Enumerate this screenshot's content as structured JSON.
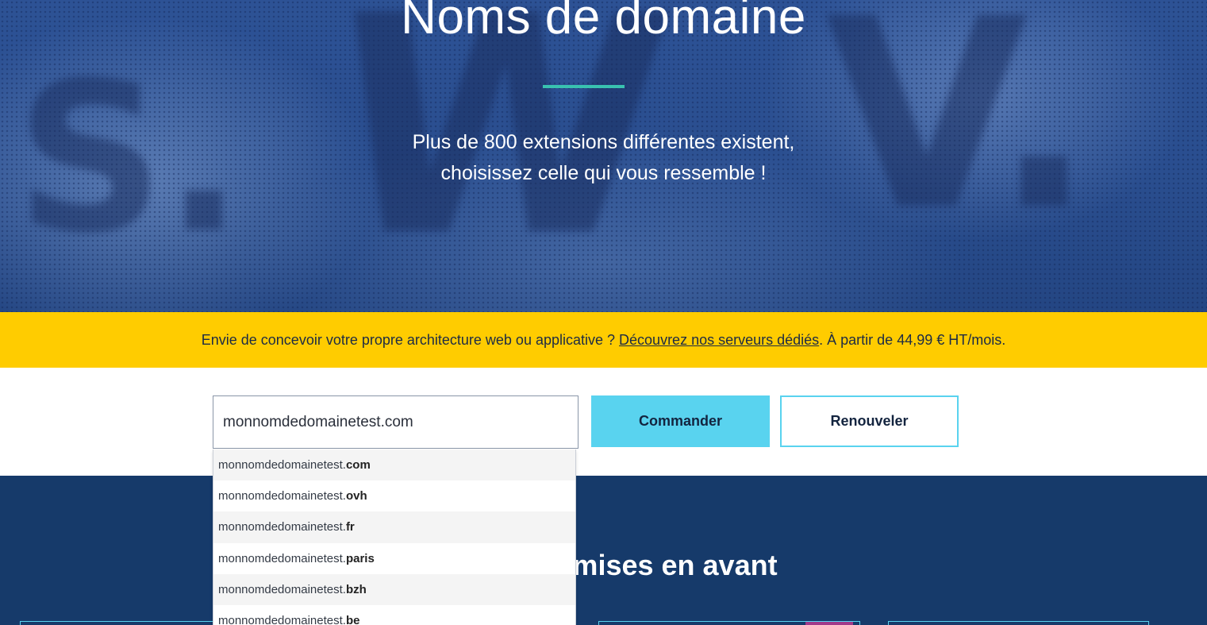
{
  "hero": {
    "title": "Noms de domaine",
    "subtitle_line1": "Plus de 800 extensions différentes existent,",
    "subtitle_line2": "choisissez celle qui vous ressemble !",
    "background_glyphs": [
      "S.",
      "W",
      "V."
    ]
  },
  "banner": {
    "text_before": "Envie de concevoir votre propre architecture web ou applicative ? ",
    "link": "Découvrez nos serveurs dédiés",
    "text_after": ". À partir de 44,99 € HT/mois."
  },
  "search": {
    "value": "monnomdedomainetest.com",
    "order_button": "Commander",
    "renew_button": "Renouveler"
  },
  "suggestions": [
    {
      "base": "monnomdedomainetest.",
      "ext": "com"
    },
    {
      "base": "monnomdedomainetest.",
      "ext": "ovh"
    },
    {
      "base": "monnomdedomainetest.",
      "ext": "fr"
    },
    {
      "base": "monnomdedomainetest.",
      "ext": "paris"
    },
    {
      "base": "monnomdedomainetest.",
      "ext": "bzh"
    },
    {
      "base": "monnomdedomainetest.",
      "ext": "be"
    }
  ],
  "featured": {
    "title_visible": "s mises en avant"
  },
  "colors": {
    "accent_teal": "#39c2b0",
    "banner_yellow": "#ffcc00",
    "button_cyan": "#59d3ef",
    "dark_navy": "#163a6a",
    "tag_purple": "#a03a8a"
  }
}
